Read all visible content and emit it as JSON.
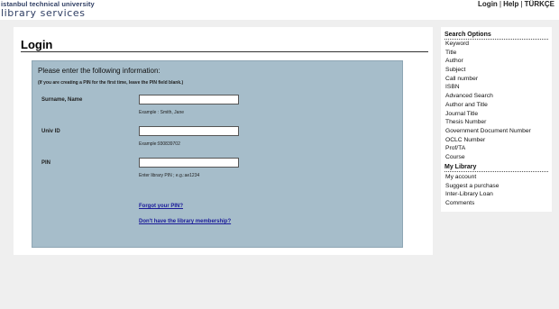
{
  "header": {
    "logo_line1": "istanbul technical university",
    "logo_line2": "library services",
    "links": [
      "Login",
      "Help",
      "TÜRKÇE"
    ],
    "separator": "|"
  },
  "main": {
    "title": "Login",
    "heading": "Please enter the following information:",
    "note": "(If you are creating a PIN for the first time, leave the PIN field blank.)",
    "fields": [
      {
        "label": "Surname, Name",
        "value": "",
        "hint": "Example : Smith, Jane"
      },
      {
        "label": "Univ ID",
        "value": "",
        "hint": "Example:930839702"
      },
      {
        "label": "PIN",
        "value": "",
        "hint": "Enter library PIN ; e.g.:ae1234"
      }
    ],
    "forgot_pin": "Forgot your PIN?",
    "membership": "Don't have the library membership?"
  },
  "sidebar": {
    "search_heading": "Search Options",
    "search_items": [
      "Keyword",
      "Title",
      "Author",
      "Subject",
      "Call number",
      "ISBN",
      "Advanced Search",
      "Author and Title",
      "Journal Title",
      "Thesis Number",
      "Government Document Number",
      "OCLC Number",
      "Prof/TA",
      "Course"
    ],
    "library_heading": "My Library",
    "library_items": [
      "My account",
      "Suggest a purchase",
      "Inter-Library Loan",
      "Comments"
    ]
  },
  "colors": {
    "page_bg": "#efefef",
    "box_bg": "#a6bdca",
    "link": "#1a1a99",
    "logo": "#2f3e63"
  }
}
